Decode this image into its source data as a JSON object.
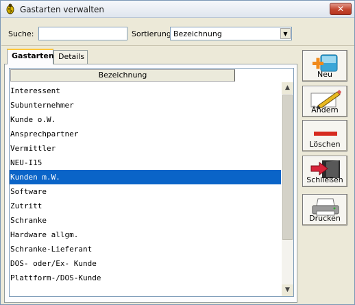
{
  "window": {
    "title": "Gastarten verwalten",
    "close_glyph": "✕"
  },
  "search": {
    "label": "Suche:",
    "value": "",
    "placeholder": ""
  },
  "sort": {
    "label": "Sortierung:",
    "selected": "Bezeichnung"
  },
  "tabs": [
    {
      "label": "Gastarten",
      "active": true
    },
    {
      "label": "Details",
      "active": false
    }
  ],
  "list": {
    "column_header": "Bezeichnung",
    "rows": [
      "Interessent",
      "Subunternehmer",
      "Kunde o.W.",
      "Ansprechpartner",
      "Vermittler",
      "NEU-I15",
      "Kunden m.W.",
      "Software",
      "Zutritt",
      "Schranke",
      "Hardware allgm.",
      "Schranke-Lieferant",
      "DOS- oder/Ex- Kunde",
      "Plattform-/DOS-Kunde"
    ],
    "selected_index": 6
  },
  "buttons": {
    "neu": "Neu",
    "aendern": "Ändern",
    "loeschen": "Löschen",
    "schliessen": "Schließen",
    "drucken": "Drucken"
  },
  "colors": {
    "selection": "#0a64c8",
    "titlebar_close": "#c3462f"
  },
  "icons": {
    "app": "bug-icon",
    "neu": "new-record-icon",
    "aendern": "pencil-icon",
    "loeschen": "minus-icon",
    "schliessen": "exit-door-icon",
    "drucken": "printer-icon"
  }
}
